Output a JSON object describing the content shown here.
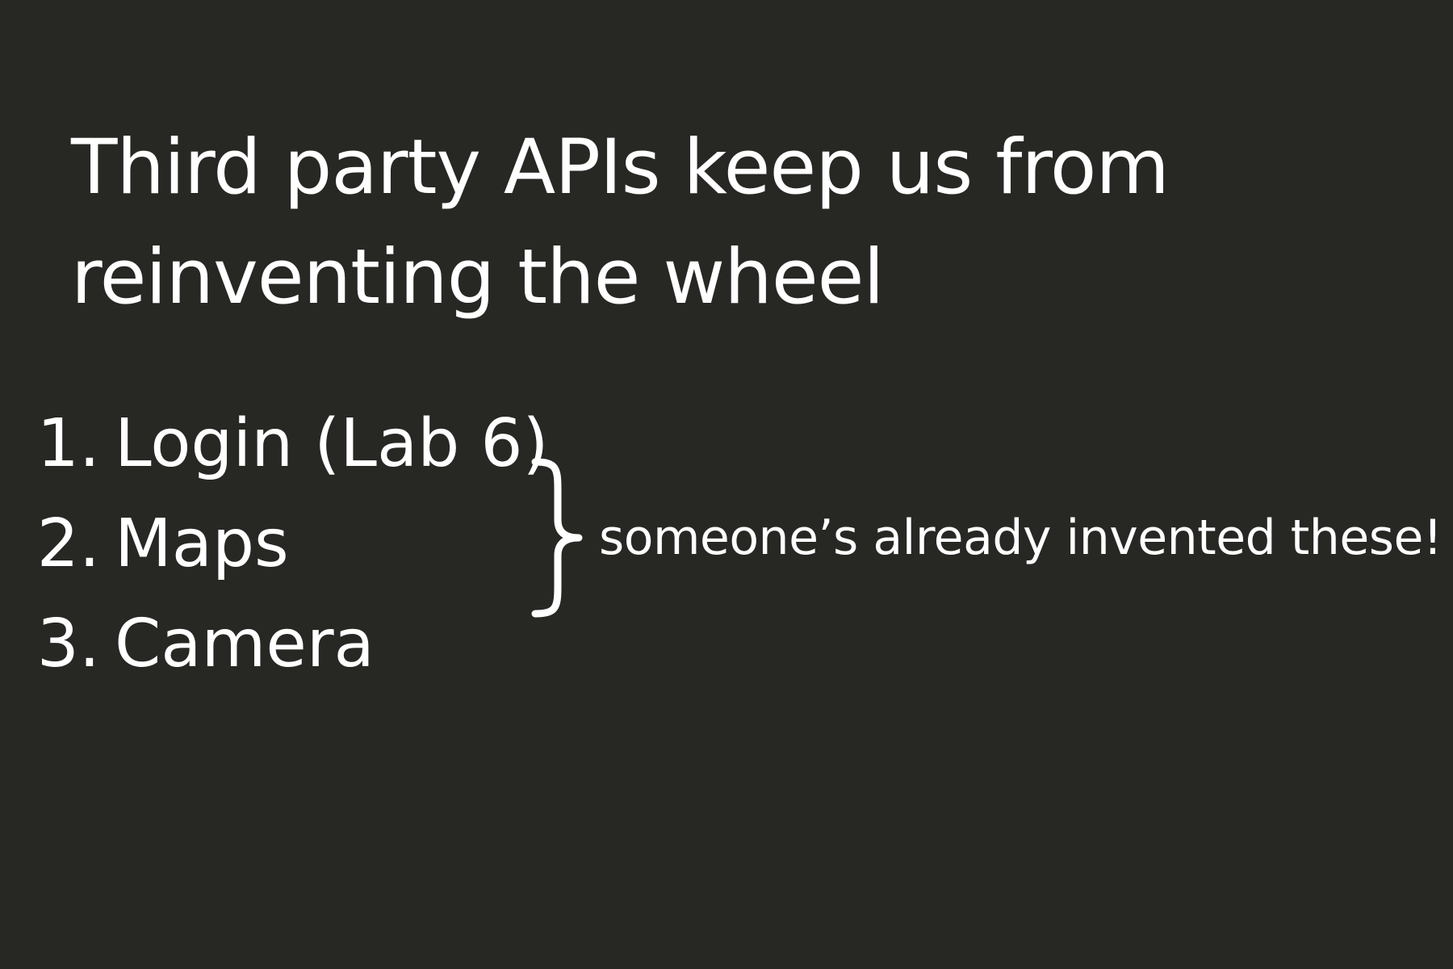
{
  "slide": {
    "title_lines": [
      "Third party APIs keep us from",
      "reinventing the wheel"
    ],
    "items": [
      {
        "number": "1.",
        "label": "Login (Lab 6)"
      },
      {
        "number": "2.",
        "label": "Maps"
      },
      {
        "number": "3.",
        "label": "Camera"
      }
    ],
    "note": "someone’s already invented these!",
    "brace_icon": "right-curly-brace-icon",
    "colors": {
      "background": "#272824",
      "text": "#ffffff"
    }
  }
}
